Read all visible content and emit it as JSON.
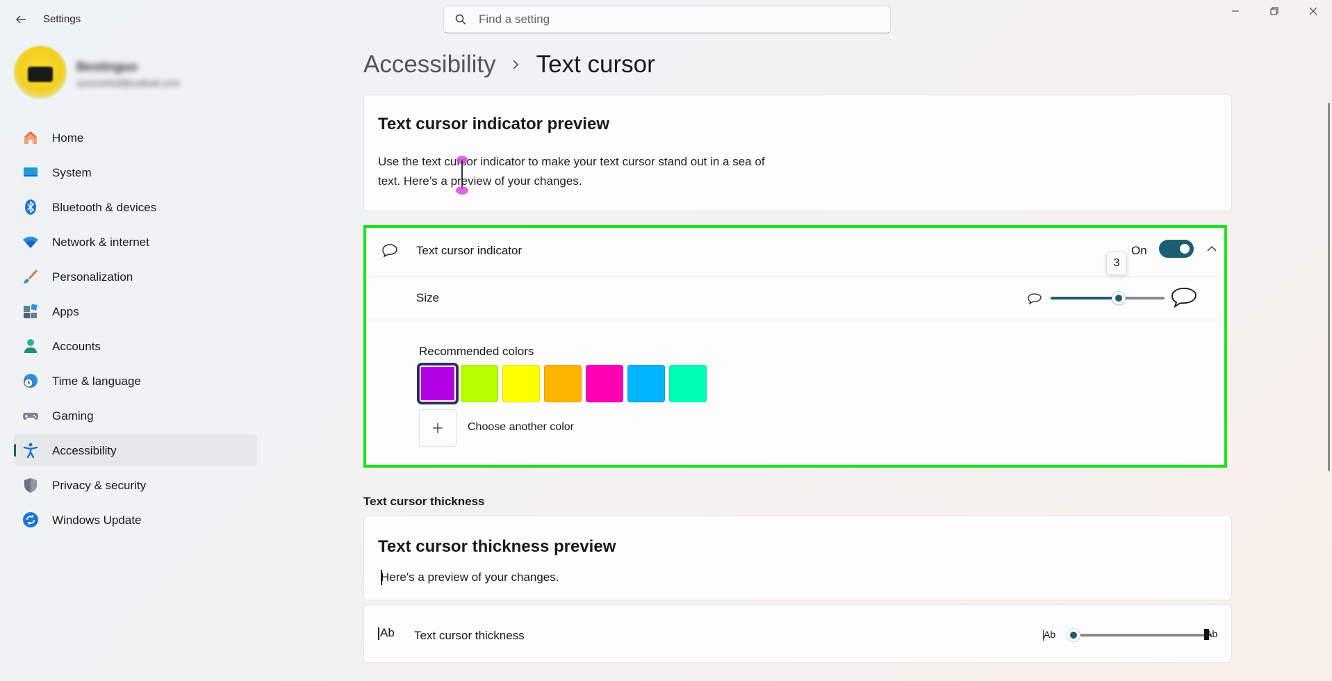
{
  "window": {
    "title": "Settings",
    "search_placeholder": "Find a setting"
  },
  "profile": {
    "name": "Bestinguo",
    "email": "sysoow4od@outlook.com"
  },
  "sidebar": {
    "items": [
      {
        "label": "Home",
        "icon": "home-icon"
      },
      {
        "label": "System",
        "icon": "system-icon"
      },
      {
        "label": "Bluetooth & devices",
        "icon": "bluetooth-icon"
      },
      {
        "label": "Network & internet",
        "icon": "wifi-icon"
      },
      {
        "label": "Personalization",
        "icon": "brush-icon"
      },
      {
        "label": "Apps",
        "icon": "apps-icon"
      },
      {
        "label": "Accounts",
        "icon": "accounts-icon"
      },
      {
        "label": "Time & language",
        "icon": "globe-clock-icon"
      },
      {
        "label": "Gaming",
        "icon": "gamepad-icon"
      },
      {
        "label": "Accessibility",
        "icon": "accessibility-icon",
        "active": true
      },
      {
        "label": "Privacy & security",
        "icon": "shield-icon"
      },
      {
        "label": "Windows Update",
        "icon": "update-icon"
      }
    ]
  },
  "breadcrumb": {
    "parent": "Accessibility",
    "current": "Text cursor"
  },
  "preview": {
    "title": "Text cursor indicator preview",
    "body": "Use the text cursor indicator to make your text cursor stand out in a sea of text. Here’s a preview of your changes."
  },
  "indicator": {
    "label": "Text cursor indicator",
    "toggle_state": "On",
    "toggle_on": true,
    "size_label": "Size",
    "size_value": "3",
    "size_fraction": 0.6,
    "colors_label": "Recommended colors",
    "colors": [
      "#b400e4",
      "#b4ff00",
      "#ffff00",
      "#ffb400",
      "#ff00b4",
      "#00b4ff",
      "#00ffb4"
    ],
    "selected_color_index": 0,
    "choose_color_label": "Choose another color"
  },
  "thickness": {
    "section_label": "Text cursor thickness",
    "preview_title": "Text cursor thickness preview",
    "preview_body": "Here's a preview of your changes.",
    "row_icon": "Ab",
    "row_label": "Text cursor thickness",
    "small_label": "Ab",
    "large_label": "Ab",
    "value_fraction": 0.0
  },
  "colors": {
    "accent": "#1b5e72",
    "highlight_border": "#16e616"
  }
}
